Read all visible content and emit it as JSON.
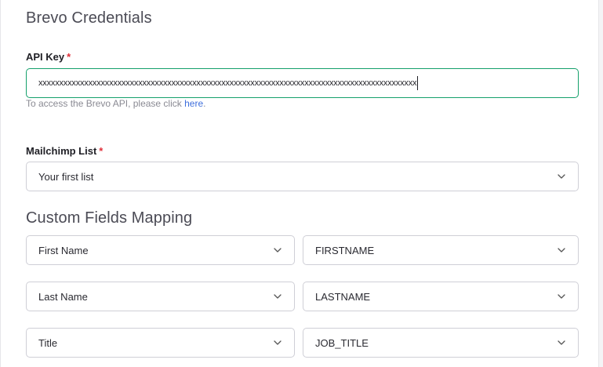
{
  "credentials": {
    "title": "Brevo Credentials",
    "api_key": {
      "label": "API Key",
      "required_mark": "*",
      "value": "xxxxxxxxxxxxxxxxxxxxxxxxxxxxxxxxxxxxxxxxxxxxxxxxxxxxxxxxxxxxxxxxxxxxxxxxxxxxxxxxxxxxxxxxxxx",
      "help_text": "To access the Brevo API, please click",
      "help_link": "here",
      "help_suffix": "."
    },
    "list": {
      "label": "Mailchimp List",
      "required_mark": "*",
      "value": "Your first list"
    }
  },
  "mapping": {
    "title": "Custom Fields Mapping",
    "rows": [
      {
        "source": "First Name",
        "target": "FIRSTNAME"
      },
      {
        "source": "Last Name",
        "target": "LASTNAME"
      },
      {
        "source": "Title",
        "target": "JOB_TITLE"
      }
    ]
  },
  "icons": {
    "dropdown": "chevron-down-icon"
  },
  "colors": {
    "focus_border": "#14a06b",
    "required": "#e0303a",
    "link": "#3f6fdc"
  }
}
